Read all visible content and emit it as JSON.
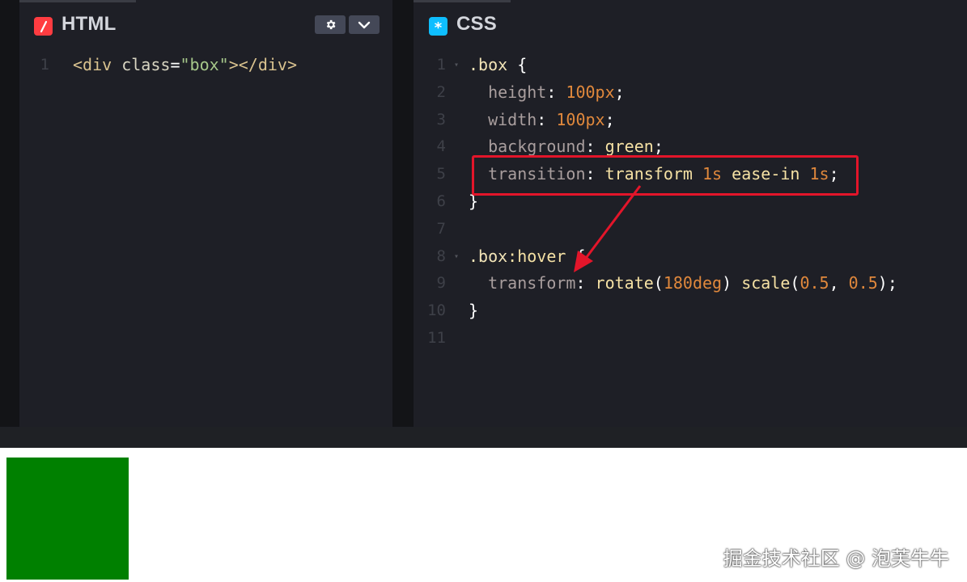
{
  "html_panel": {
    "title": "HTML",
    "icon": "slash-icon",
    "icon_color": "#ff3c41",
    "lines": [
      {
        "n": "1",
        "tokens": [
          {
            "t": "<div ",
            "c": "tag"
          },
          {
            "t": "class",
            "c": "attr"
          },
          {
            "t": "=",
            "c": "white"
          },
          {
            "t": "\"box\"",
            "c": "str"
          },
          {
            "t": "></div>",
            "c": "tag"
          }
        ]
      }
    ]
  },
  "css_panel": {
    "title": "CSS",
    "icon": "asterisk-icon",
    "icon_color": "#0ebeff",
    "lines": [
      {
        "n": "1",
        "fold": true,
        "tokens": [
          {
            "t": ".box",
            "c": "sel"
          },
          {
            "t": " {",
            "c": "punc"
          }
        ]
      },
      {
        "n": "2",
        "tokens": [
          {
            "t": "  height",
            "c": "prop"
          },
          {
            "t": ": ",
            "c": "punc"
          },
          {
            "t": "100px",
            "c": "num"
          },
          {
            "t": ";",
            "c": "punc"
          }
        ]
      },
      {
        "n": "3",
        "tokens": [
          {
            "t": "  width",
            "c": "prop"
          },
          {
            "t": ": ",
            "c": "punc"
          },
          {
            "t": "100px",
            "c": "num"
          },
          {
            "t": ";",
            "c": "punc"
          }
        ]
      },
      {
        "n": "4",
        "tokens": [
          {
            "t": "  background",
            "c": "prop"
          },
          {
            "t": ": ",
            "c": "punc"
          },
          {
            "t": "green",
            "c": "val"
          },
          {
            "t": ";",
            "c": "punc"
          }
        ]
      },
      {
        "n": "5",
        "tokens": [
          {
            "t": "  transition",
            "c": "prop"
          },
          {
            "t": ": ",
            "c": "punc"
          },
          {
            "t": "transform ",
            "c": "val"
          },
          {
            "t": "1s",
            "c": "num"
          },
          {
            "t": " ease-in ",
            "c": "val"
          },
          {
            "t": "1s",
            "c": "num"
          },
          {
            "t": ";",
            "c": "punc"
          }
        ]
      },
      {
        "n": "6",
        "tokens": [
          {
            "t": "}",
            "c": "punc"
          }
        ]
      },
      {
        "n": "7",
        "tokens": []
      },
      {
        "n": "8",
        "fold": true,
        "tokens": [
          {
            "t": ".box",
            "c": "sel"
          },
          {
            "t": ":hover",
            "c": "val"
          },
          {
            "t": " {",
            "c": "punc"
          }
        ]
      },
      {
        "n": "9",
        "tokens": [
          {
            "t": "  transform",
            "c": "prop"
          },
          {
            "t": ": ",
            "c": "punc"
          },
          {
            "t": "rotate",
            "c": "val"
          },
          {
            "t": "(",
            "c": "punc"
          },
          {
            "t": "180deg",
            "c": "num"
          },
          {
            "t": ") ",
            "c": "punc"
          },
          {
            "t": "scale",
            "c": "val"
          },
          {
            "t": "(",
            "c": "punc"
          },
          {
            "t": "0.5",
            "c": "num"
          },
          {
            "t": ", ",
            "c": "punc"
          },
          {
            "t": "0.5",
            "c": "num"
          },
          {
            "t": ");",
            "c": "punc"
          }
        ]
      },
      {
        "n": "10",
        "tokens": [
          {
            "t": "}",
            "c": "punc"
          }
        ]
      },
      {
        "n": "11",
        "tokens": []
      }
    ]
  },
  "toolbar": {
    "settings_icon": "gear-icon",
    "collapse_icon": "chevron-down-icon"
  },
  "preview": {
    "box_color": "#008000"
  },
  "watermark": "掘金技术社区 @ 泡芙牛牛",
  "colors": {
    "highlight": "#e3152a"
  }
}
